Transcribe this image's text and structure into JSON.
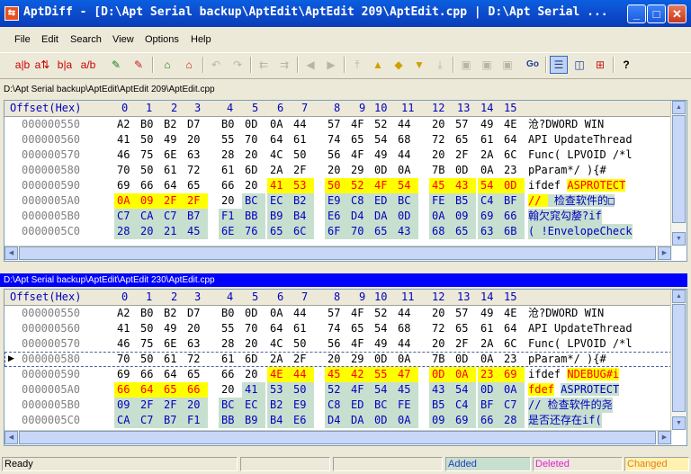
{
  "window": {
    "title": "AptDiff - [D:\\Apt Serial backup\\AptEdit\\AptEdit 209\\AptEdit.cpp | D:\\Apt Serial ...",
    "app_icon": "aptdiff-app-icon",
    "minimize": "_",
    "maximize": "□",
    "close": "✕"
  },
  "menu": [
    "File",
    "Edit",
    "Search",
    "View",
    "Options",
    "Help"
  ],
  "header": {
    "offset": "Offset(Hex)",
    "cols": [
      "0",
      "1",
      "2",
      "3",
      "4",
      "5",
      "6",
      "7",
      "8",
      "9",
      "10",
      "11",
      "12",
      "13",
      "14",
      "15"
    ]
  },
  "pane1": {
    "path": "D:\\Apt Serial backup\\AptEdit\\AptEdit 209\\AptEdit.cpp",
    "rows": [
      {
        "off": "000000550",
        "bytes": [
          "A2",
          "B0",
          "B2",
          "D7",
          "B0",
          "0D",
          "0A",
          "44",
          "57",
          "4F",
          "52",
          "44",
          "20",
          "57",
          "49",
          "4E"
        ],
        "hl": [
          "",
          "",
          "",
          "",
          "",
          "",
          "",
          "",
          "",
          "",
          "",
          "",
          "",
          "",
          "",
          ""
        ],
        "ascii": "沧?DWORD WIN",
        "ahl": ""
      },
      {
        "off": "000000560",
        "bytes": [
          "41",
          "50",
          "49",
          "20",
          "55",
          "70",
          "64",
          "61",
          "74",
          "65",
          "54",
          "68",
          "72",
          "65",
          "61",
          "64"
        ],
        "hl": [
          "",
          "",
          "",
          "",
          "",
          "",
          "",
          "",
          "",
          "",
          "",
          "",
          "",
          "",
          "",
          ""
        ],
        "ascii": "API UpdateThread",
        "ahl": ""
      },
      {
        "off": "000000570",
        "bytes": [
          "46",
          "75",
          "6E",
          "63",
          "28",
          "20",
          "4C",
          "50",
          "56",
          "4F",
          "49",
          "44",
          "20",
          "2F",
          "2A",
          "6C"
        ],
        "hl": [
          "",
          "",
          "",
          "",
          "",
          "",
          "",
          "",
          "",
          "",
          "",
          "",
          "",
          "",
          "",
          ""
        ],
        "ascii": "Func( LPVOID /*l",
        "ahl": ""
      },
      {
        "off": "000000580",
        "bytes": [
          "70",
          "50",
          "61",
          "72",
          "61",
          "6D",
          "2A",
          "2F",
          "20",
          "29",
          "0D",
          "0A",
          "7B",
          "0D",
          "0A",
          "23"
        ],
        "hl": [
          "",
          "",
          "",
          "",
          "",
          "",
          "",
          "",
          "",
          "",
          "",
          "",
          "",
          "",
          "",
          ""
        ],
        "ascii": "pParam*/ ){#",
        "ahl": ""
      },
      {
        "off": "000000590",
        "bytes": [
          "69",
          "66",
          "64",
          "65",
          "66",
          "20",
          "41",
          "53",
          "50",
          "52",
          "4F",
          "54",
          "45",
          "43",
          "54",
          "0D"
        ],
        "hl": [
          "",
          "",
          "",
          "",
          "",
          "",
          "y",
          "y",
          "y",
          "y",
          "y",
          "y",
          "y",
          "y",
          "y",
          "y"
        ],
        "ascii": "ifdef ASPROTECT",
        "ahl": "y6"
      },
      {
        "off": "0000005A0",
        "bytes": [
          "0A",
          "09",
          "2F",
          "2F",
          "20",
          "BC",
          "EC",
          "B2",
          "E9",
          "C8",
          "ED",
          "BC",
          "FE",
          "B5",
          "C4",
          "BF"
        ],
        "hl": [
          "y",
          "y",
          "y",
          "y",
          "",
          "g",
          "g",
          "g",
          "g",
          "g",
          "g",
          "g",
          "g",
          "g",
          "g",
          "g"
        ],
        "ascii": "//  检查软件的□",
        "ahl": "mix"
      },
      {
        "off": "0000005B0",
        "bytes": [
          "C7",
          "CA",
          "C7",
          "B7",
          "F1",
          "BB",
          "B9",
          "B4",
          "E6",
          "D4",
          "DA",
          "0D",
          "0A",
          "09",
          "69",
          "66"
        ],
        "hl": [
          "g",
          "g",
          "g",
          "g",
          "g",
          "g",
          "g",
          "g",
          "g",
          "g",
          "g",
          "g",
          "g",
          "g",
          "g",
          "g"
        ],
        "ascii": "翰欠窕勾嫠?if",
        "ahl": "g"
      },
      {
        "off": "0000005C0",
        "bytes": [
          "28",
          "20",
          "21",
          "45",
          "6E",
          "76",
          "65",
          "6C",
          "6F",
          "70",
          "65",
          "43",
          "68",
          "65",
          "63",
          "6B"
        ],
        "hl": [
          "g",
          "g",
          "g",
          "g",
          "g",
          "g",
          "g",
          "g",
          "g",
          "g",
          "g",
          "g",
          "g",
          "g",
          "g",
          "g"
        ],
        "ascii": "( !EnvelopeCheck",
        "ahl": "g"
      }
    ]
  },
  "pane2": {
    "path": "D:\\Apt Serial backup\\AptEdit\\AptEdit 230\\AptEdit.cpp",
    "rows": [
      {
        "off": "000000550",
        "bytes": [
          "A2",
          "B0",
          "B2",
          "D7",
          "B0",
          "0D",
          "0A",
          "44",
          "57",
          "4F",
          "52",
          "44",
          "20",
          "57",
          "49",
          "4E"
        ],
        "hl": [
          "",
          "",
          "",
          "",
          "",
          "",
          "",
          "",
          "",
          "",
          "",
          "",
          "",
          "",
          "",
          ""
        ],
        "ascii": "沧?DWORD WIN",
        "ahl": ""
      },
      {
        "off": "000000560",
        "bytes": [
          "41",
          "50",
          "49",
          "20",
          "55",
          "70",
          "64",
          "61",
          "74",
          "65",
          "54",
          "68",
          "72",
          "65",
          "61",
          "64"
        ],
        "hl": [
          "",
          "",
          "",
          "",
          "",
          "",
          "",
          "",
          "",
          "",
          "",
          "",
          "",
          "",
          "",
          ""
        ],
        "ascii": "API UpdateThread",
        "ahl": ""
      },
      {
        "off": "000000570",
        "bytes": [
          "46",
          "75",
          "6E",
          "63",
          "28",
          "20",
          "4C",
          "50",
          "56",
          "4F",
          "49",
          "44",
          "20",
          "2F",
          "2A",
          "6C"
        ],
        "hl": [
          "",
          "",
          "",
          "",
          "",
          "",
          "",
          "",
          "",
          "",
          "",
          "",
          "",
          "",
          "",
          ""
        ],
        "ascii": "Func( LPVOID /*l",
        "ahl": ""
      },
      {
        "off": "000000580",
        "bytes": [
          "70",
          "50",
          "61",
          "72",
          "61",
          "6D",
          "2A",
          "2F",
          "20",
          "29",
          "0D",
          "0A",
          "7B",
          "0D",
          "0A",
          "23"
        ],
        "hl": [
          "",
          "",
          "",
          "",
          "",
          "",
          "",
          "",
          "",
          "",
          "",
          "",
          "",
          "",
          "",
          ""
        ],
        "ascii": "pParam*/ ){#",
        "ahl": "",
        "current": true
      },
      {
        "off": "000000590",
        "bytes": [
          "69",
          "66",
          "64",
          "65",
          "66",
          "20",
          "4E",
          "44",
          "45",
          "42",
          "55",
          "47",
          "0D",
          "0A",
          "23",
          "69"
        ],
        "hl": [
          "",
          "",
          "",
          "",
          "",
          "",
          "y",
          "y",
          "y",
          "y",
          "y",
          "y",
          "y",
          "y",
          "y",
          "y"
        ],
        "ascii": "ifdef NDEBUG#i",
        "ahl": "y6"
      },
      {
        "off": "0000005A0",
        "bytes": [
          "66",
          "64",
          "65",
          "66",
          "20",
          "41",
          "53",
          "50",
          "52",
          "4F",
          "54",
          "45",
          "43",
          "54",
          "0D",
          "0A"
        ],
        "hl": [
          "y",
          "y",
          "y",
          "y",
          "",
          "g",
          "g",
          "g",
          "g",
          "g",
          "g",
          "g",
          "g",
          "g",
          "g",
          "g"
        ],
        "ascii": "fdef ASPROTECT",
        "ahl": "mix2"
      },
      {
        "off": "0000005B0",
        "bytes": [
          "09",
          "2F",
          "2F",
          "20",
          "BC",
          "EC",
          "B2",
          "E9",
          "C8",
          "ED",
          "BC",
          "FE",
          "B5",
          "C4",
          "BF",
          "C7"
        ],
        "hl": [
          "g",
          "g",
          "g",
          "g",
          "g",
          "g",
          "g",
          "g",
          "g",
          "g",
          "g",
          "g",
          "g",
          "g",
          "g",
          "g"
        ],
        "ascii": "// 检查软件的尧",
        "ahl": "g"
      },
      {
        "off": "0000005C0",
        "bytes": [
          "CA",
          "C7",
          "B7",
          "F1",
          "BB",
          "B9",
          "B4",
          "E6",
          "D4",
          "DA",
          "0D",
          "0A",
          "09",
          "69",
          "66",
          "28"
        ],
        "hl": [
          "g",
          "g",
          "g",
          "g",
          "g",
          "g",
          "g",
          "g",
          "g",
          "g",
          "g",
          "g",
          "g",
          "g",
          "g",
          "g"
        ],
        "ascii": "是否还存在if(",
        "ahl": "g"
      }
    ]
  },
  "status": {
    "ready": "Ready",
    "added": "Added",
    "deleted": "Deleted",
    "changed": "Changed",
    "colors": {
      "added": "#1d3fbf",
      "deleted": "#e020e0",
      "changed": "#e08020"
    }
  }
}
